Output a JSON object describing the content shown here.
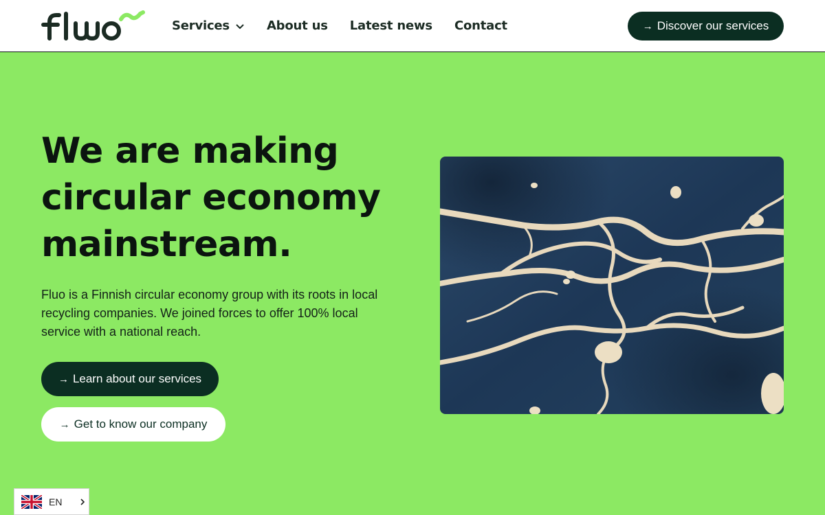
{
  "header": {
    "logo_text": "fluo",
    "nav": [
      {
        "label": "Services",
        "has_dropdown": true
      },
      {
        "label": "About us"
      },
      {
        "label": "Latest news"
      },
      {
        "label": "Contact"
      }
    ],
    "cta_label": "Discover our services"
  },
  "hero": {
    "title_lines": [
      "We are making",
      "circular economy",
      "mainstream."
    ],
    "description": "Fluo is a Finnish circular economy group with its roots in local recycling companies. We joined forces to offer 100% local service with a national reach.",
    "primary_button": "Learn about our services",
    "secondary_button": "Get to know our company",
    "arrow": "→",
    "image_icon": "aerial-river-delta-photo"
  },
  "language": {
    "code": "EN",
    "flag_icon": "uk-flag-icon"
  },
  "colors": {
    "background": "#8ce963",
    "dark_green": "#0b2e22",
    "logo_accent": "#8ce963",
    "header_bg": "#ffffff"
  }
}
